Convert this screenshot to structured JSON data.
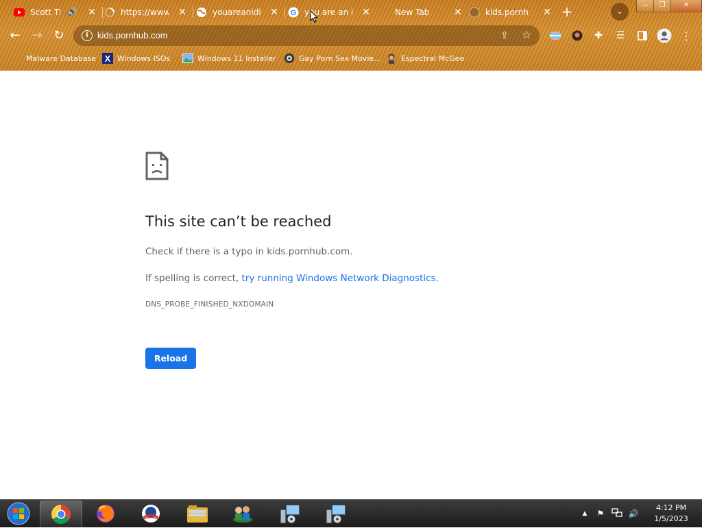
{
  "tabs": [
    {
      "title": "Scott Th",
      "favicon": "youtube-icon",
      "audio": true
    },
    {
      "title": "https://www",
      "favicon": "loading-spinner-icon",
      "audio": false
    },
    {
      "title": "youareanidiot",
      "favicon": "globe-icon",
      "audio": false
    },
    {
      "title": "you are an id",
      "favicon": "google-icon",
      "audio": false,
      "active": true
    },
    {
      "title": "New Tab",
      "favicon": "",
      "audio": false
    },
    {
      "title": "kids.pornhub",
      "favicon": "globe-icon",
      "audio": false
    }
  ],
  "tab_close_glyph": "✕",
  "new_tab_glyph": "+",
  "window_controls": {
    "minimize": "—",
    "maximize": "❐",
    "close": "✕"
  },
  "omnibox": {
    "url": "kids.pornhub.com"
  },
  "bookmarks": [
    {
      "label": "Malware Database",
      "icon": "none"
    },
    {
      "label": "Windows ISOs",
      "icon": "x-logo-icon"
    },
    {
      "label": "Windows 11 Installer",
      "icon": "image-icon"
    },
    {
      "label": "Gay Porn Sex Movie...",
      "icon": "site-icon"
    },
    {
      "label": "Espectral McGee",
      "icon": "avatar-icon"
    }
  ],
  "error": {
    "title": "This site can’t be reached",
    "line1": "Check if there is a typo in kids.pornhub.com.",
    "line2_prefix": "If spelling is correct, ",
    "line2_link": "try running Windows Network Diagnostics",
    "line2_suffix": ".",
    "code": "DNS_PROBE_FINISHED_NXDOMAIN",
    "reload_label": "Reload"
  },
  "taskbar": {
    "apps": [
      "chrome",
      "firefox",
      "obama",
      "file-explorer",
      "network-users",
      "setup",
      "setup"
    ],
    "time": "4:12 PM",
    "date": "1/5/2023"
  },
  "colors": {
    "theme_orange": "#c97a1c",
    "link_blue": "#1a73e8",
    "title_text": "#202124",
    "body_text": "#5f6368"
  }
}
